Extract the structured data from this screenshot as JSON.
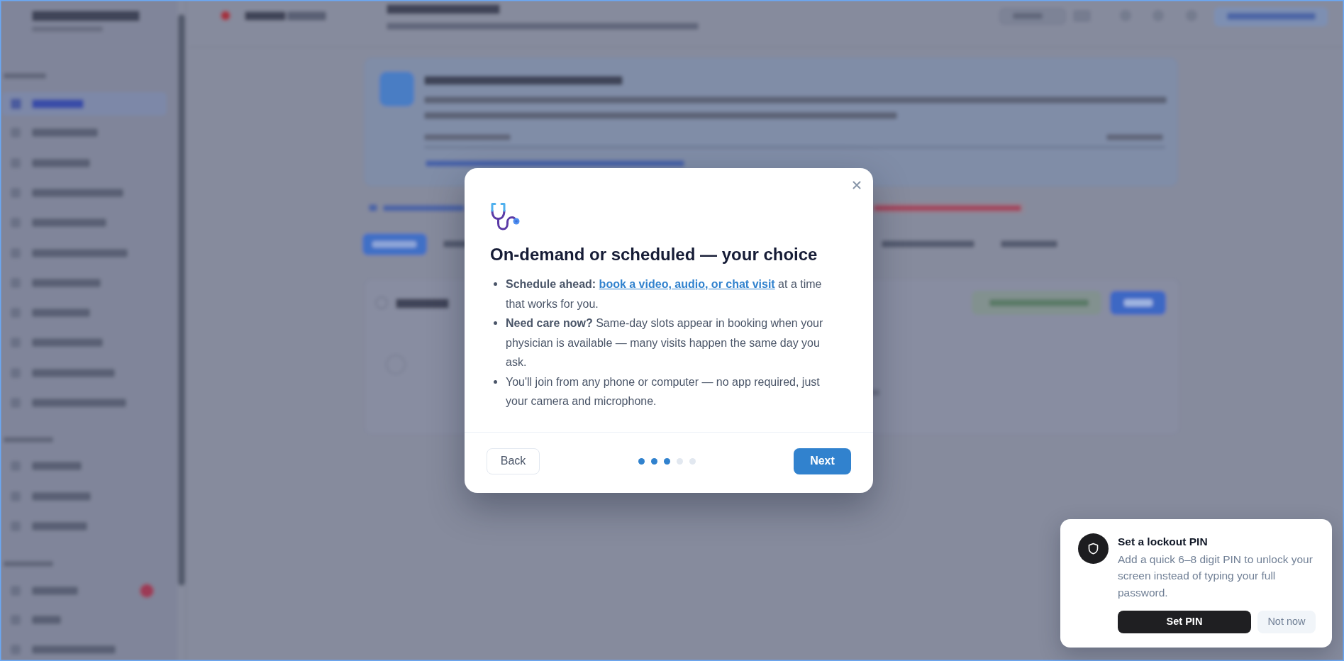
{
  "modal": {
    "title": "On-demand or scheduled — your choice",
    "points": [
      {
        "text": "**Schedule ahead:** ",
        "link": "book a video, audio, or chat visit",
        "text_after": " at a time that works for you."
      },
      {
        "text": "**Need care now?** Same-day slots appear in booking when your physician is available — many visits happen the same day you ask."
      },
      {
        "text": "You'll join from any phone or computer — no app required, just your camera and microphone."
      }
    ],
    "back_button": "Back",
    "next_button": "Next",
    "steps": [
      {
        "filled": true
      },
      {
        "filled": true
      },
      {
        "filled": true
      },
      {
        "filled": false
      },
      {
        "filled": false
      }
    ]
  },
  "toast": {
    "title": "Set a lockout PIN",
    "message": "Add a quick 6–8 digit PIN to unlock your screen instead of typing your full password.",
    "primary_button": "Set PIN",
    "secondary_button": "Not now"
  }
}
